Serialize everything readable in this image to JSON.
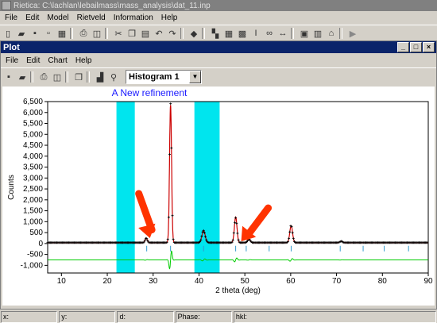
{
  "window": {
    "title": "Rietica: C:\\lachlan\\lebailmass\\mass_analysis\\dat_11.inp"
  },
  "menu": [
    "File",
    "Edit",
    "Model",
    "Rietveld",
    "Information",
    "Help"
  ],
  "child": {
    "title": "Plot",
    "menu": [
      "File",
      "Edit",
      "Chart",
      "Help"
    ],
    "histogram_select": "Histogram 1"
  },
  "chart_data": {
    "type": "line",
    "title": "A New refinement",
    "xlabel": "2 theta (deg)",
    "ylabel": "Counts",
    "xlim": [
      7,
      90
    ],
    "ylim": [
      -1350,
      6500
    ],
    "xticks": [
      10,
      20,
      30,
      40,
      50,
      60,
      70,
      80,
      90
    ],
    "yticks": [
      6500,
      6000,
      5500,
      5000,
      4500,
      4000,
      3500,
      3000,
      2500,
      2000,
      1500,
      1000,
      500,
      0,
      -500,
      -1000
    ],
    "ytick_labels": [
      "6,500",
      "6,000",
      "5,500",
      "5,000",
      "4,500",
      "4,000",
      "3,500",
      "3,000",
      "2,500",
      "2,000",
      "1,500",
      "1,000",
      "500",
      "0",
      "-500",
      "-1,000"
    ],
    "excluded_regions": [
      [
        22,
        26
      ],
      [
        39,
        44.5
      ]
    ],
    "peaks": [
      {
        "x": 28.5,
        "y": 200,
        "w": 0.25
      },
      {
        "x": 33.8,
        "y": 6300,
        "w": 0.22
      },
      {
        "x": 41.0,
        "y": 550,
        "w": 0.35
      },
      {
        "x": 48.0,
        "y": 1180,
        "w": 0.28
      },
      {
        "x": 50.9,
        "y": 150,
        "w": 0.3
      },
      {
        "x": 60.1,
        "y": 780,
        "w": 0.3
      },
      {
        "x": 71.0,
        "y": 60,
        "w": 0.3
      }
    ],
    "background": 40,
    "difference_offset": -750,
    "tick_offset": -250,
    "reflection_ticks": [
      28.6,
      33.8,
      41.0,
      48.0,
      50.3,
      55.3,
      60.1,
      70.8,
      75.8,
      80.4,
      85.7
    ],
    "annotation_arrows": [
      {
        "tip_x": 29.3,
        "tip_y": 250
      },
      {
        "tip_x": 49.2,
        "tip_y": 100
      }
    ],
    "colors": {
      "observed": "#000000",
      "calculated": "#cc0000",
      "difference": "#00cc00",
      "excluded": "#00e5ee",
      "ticks": "#3399cc",
      "arrow": "#ff3300",
      "title": "#1a1aff"
    }
  },
  "status": {
    "x": "x:",
    "y": "y:",
    "d": "d:",
    "phase": "Phase:",
    "hkl": "hkl:"
  }
}
